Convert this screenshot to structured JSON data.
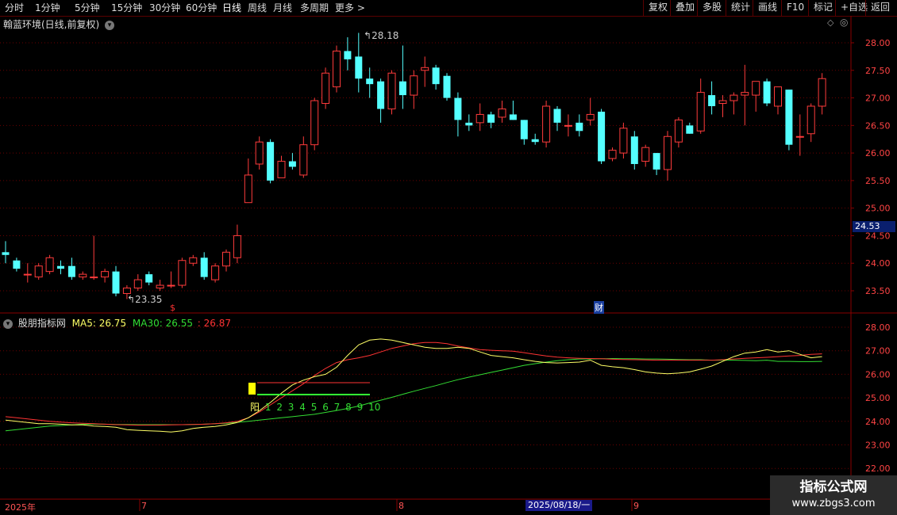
{
  "toolbar": {
    "periods": [
      "分时",
      "1分钟",
      "5分钟",
      "15分钟",
      "30分钟",
      "60分钟",
      "日线",
      "周线",
      "月线",
      "多周期",
      "更多 >"
    ],
    "active_period": "日线",
    "right_buttons": [
      "复权",
      "叠加",
      "多股",
      "统计",
      "画线",
      "F10",
      "标记",
      "+自选",
      "返回"
    ]
  },
  "main_chart": {
    "title": "翰蓝环境(日线,前复权)",
    "price_axis": [
      "28.00",
      "27.50",
      "27.00",
      "26.50",
      "26.00",
      "25.50",
      "25.00",
      "24.50",
      "24.00",
      "23.50"
    ],
    "high_label": "28.18",
    "low_label": "23.35",
    "current_price": "24.53",
    "event_marker_1": "$",
    "event_marker_2": "财"
  },
  "indicator": {
    "name": "股朋指标网",
    "ma5_label": "MA5: 26.75",
    "ma30_label": "MA30: 26.55",
    "extra_value": ": 26.87",
    "count_labels": [
      "阳",
      "1",
      "2",
      "3",
      "4",
      "5",
      "6",
      "7",
      "8",
      "9",
      "10"
    ],
    "axis": [
      "28.00",
      "27.00",
      "26.00",
      "25.00",
      "24.00",
      "23.00",
      "22.00"
    ]
  },
  "time_axis": {
    "labels": [
      "2025年",
      "7",
      "8",
      "9"
    ],
    "cursor_date": "2025/08/18/一"
  },
  "watermark": {
    "line1": "指标公式网",
    "line2": "www.zbgs3.com"
  },
  "colors": {
    "up": "#ff3b3b",
    "down": "#54ffff",
    "ma5": "#ffff66",
    "ma30": "#33dd33",
    "ma_red": "#ff3333",
    "grid": "#6a0000"
  },
  "chart_data": {
    "type": "candlestick",
    "ylim": [
      23.2,
      28.3
    ],
    "candles": [
      {
        "o": 24.2,
        "h": 24.4,
        "l": 24.0,
        "c": 24.15
      },
      {
        "o": 24.05,
        "h": 24.1,
        "l": 23.85,
        "c": 23.9
      },
      {
        "o": 23.8,
        "h": 24.0,
        "l": 23.65,
        "c": 23.8
      },
      {
        "o": 23.75,
        "h": 24.0,
        "l": 23.7,
        "c": 23.95
      },
      {
        "o": 23.85,
        "h": 24.15,
        "l": 23.8,
        "c": 24.1
      },
      {
        "o": 23.95,
        "h": 24.05,
        "l": 23.8,
        "c": 23.9
      },
      {
        "o": 23.95,
        "h": 24.1,
        "l": 23.7,
        "c": 23.75
      },
      {
        "o": 23.75,
        "h": 23.85,
        "l": 23.7,
        "c": 23.8
      },
      {
        "o": 23.75,
        "h": 24.5,
        "l": 23.7,
        "c": 23.75
      },
      {
        "o": 23.75,
        "h": 23.9,
        "l": 23.65,
        "c": 23.85
      },
      {
        "o": 23.85,
        "h": 23.95,
        "l": 23.4,
        "c": 23.45
      },
      {
        "o": 23.45,
        "h": 23.6,
        "l": 23.35,
        "c": 23.55
      },
      {
        "o": 23.55,
        "h": 23.8,
        "l": 23.5,
        "c": 23.7
      },
      {
        "o": 23.8,
        "h": 23.85,
        "l": 23.6,
        "c": 23.65
      },
      {
        "o": 23.55,
        "h": 23.7,
        "l": 23.5,
        "c": 23.6
      },
      {
        "o": 23.6,
        "h": 23.85,
        "l": 23.55,
        "c": 23.6
      },
      {
        "o": 23.6,
        "h": 24.1,
        "l": 23.55,
        "c": 24.05
      },
      {
        "o": 24.0,
        "h": 24.15,
        "l": 23.95,
        "c": 24.1
      },
      {
        "o": 24.1,
        "h": 24.2,
        "l": 23.7,
        "c": 23.75
      },
      {
        "o": 23.7,
        "h": 24.0,
        "l": 23.65,
        "c": 23.95
      },
      {
        "o": 23.95,
        "h": 24.25,
        "l": 23.85,
        "c": 24.2
      },
      {
        "o": 24.1,
        "h": 24.7,
        "l": 24.0,
        "c": 24.5
      },
      {
        "o": 25.1,
        "h": 25.9,
        "l": 25.1,
        "c": 25.6
      },
      {
        "o": 25.8,
        "h": 26.3,
        "l": 25.7,
        "c": 26.2
      },
      {
        "o": 26.2,
        "h": 26.25,
        "l": 25.45,
        "c": 25.5
      },
      {
        "o": 25.55,
        "h": 25.95,
        "l": 25.55,
        "c": 25.85
      },
      {
        "o": 25.85,
        "h": 26.0,
        "l": 25.7,
        "c": 25.75
      },
      {
        "o": 25.6,
        "h": 26.3,
        "l": 25.55,
        "c": 26.15
      },
      {
        "o": 26.15,
        "h": 27.0,
        "l": 26.05,
        "c": 26.95
      },
      {
        "o": 26.9,
        "h": 27.55,
        "l": 26.8,
        "c": 27.45
      },
      {
        "o": 27.2,
        "h": 27.95,
        "l": 27.1,
        "c": 27.85
      },
      {
        "o": 27.85,
        "h": 28.1,
        "l": 27.5,
        "c": 27.7
      },
      {
        "o": 27.75,
        "h": 28.18,
        "l": 27.1,
        "c": 27.35
      },
      {
        "o": 27.35,
        "h": 27.55,
        "l": 27.0,
        "c": 27.25
      },
      {
        "o": 27.3,
        "h": 27.35,
        "l": 26.55,
        "c": 26.8
      },
      {
        "o": 26.8,
        "h": 27.5,
        "l": 26.7,
        "c": 27.45
      },
      {
        "o": 27.3,
        "h": 27.95,
        "l": 26.8,
        "c": 27.05
      },
      {
        "o": 27.05,
        "h": 27.5,
        "l": 26.8,
        "c": 27.4
      },
      {
        "o": 27.5,
        "h": 27.75,
        "l": 27.2,
        "c": 27.55
      },
      {
        "o": 27.55,
        "h": 27.6,
        "l": 27.15,
        "c": 27.25
      },
      {
        "o": 27.4,
        "h": 27.45,
        "l": 26.95,
        "c": 27.0
      },
      {
        "o": 27.0,
        "h": 27.1,
        "l": 26.3,
        "c": 26.6
      },
      {
        "o": 26.55,
        "h": 26.7,
        "l": 26.4,
        "c": 26.5
      },
      {
        "o": 26.55,
        "h": 26.9,
        "l": 26.4,
        "c": 26.7
      },
      {
        "o": 26.7,
        "h": 26.75,
        "l": 26.45,
        "c": 26.55
      },
      {
        "o": 26.65,
        "h": 26.95,
        "l": 26.55,
        "c": 26.8
      },
      {
        "o": 26.7,
        "h": 26.95,
        "l": 26.6,
        "c": 26.6
      },
      {
        "o": 26.6,
        "h": 26.6,
        "l": 26.15,
        "c": 26.25
      },
      {
        "o": 26.25,
        "h": 26.35,
        "l": 26.15,
        "c": 26.2
      },
      {
        "o": 26.2,
        "h": 26.95,
        "l": 26.1,
        "c": 26.85
      },
      {
        "o": 26.8,
        "h": 26.85,
        "l": 26.4,
        "c": 26.55
      },
      {
        "o": 26.5,
        "h": 26.7,
        "l": 26.3,
        "c": 26.5
      },
      {
        "o": 26.55,
        "h": 26.7,
        "l": 26.3,
        "c": 26.4
      },
      {
        "o": 26.6,
        "h": 27.0,
        "l": 26.5,
        "c": 26.7
      },
      {
        "o": 26.75,
        "h": 26.8,
        "l": 25.8,
        "c": 25.85
      },
      {
        "o": 25.9,
        "h": 26.1,
        "l": 25.85,
        "c": 26.05
      },
      {
        "o": 26.0,
        "h": 26.55,
        "l": 25.9,
        "c": 26.45
      },
      {
        "o": 26.3,
        "h": 26.4,
        "l": 25.7,
        "c": 25.8
      },
      {
        "o": 25.85,
        "h": 26.15,
        "l": 25.75,
        "c": 26.1
      },
      {
        "o": 26.0,
        "h": 26.0,
        "l": 25.6,
        "c": 25.7
      },
      {
        "o": 25.7,
        "h": 26.4,
        "l": 25.5,
        "c": 26.3
      },
      {
        "o": 26.2,
        "h": 26.65,
        "l": 26.1,
        "c": 26.6
      },
      {
        "o": 26.5,
        "h": 26.55,
        "l": 26.35,
        "c": 26.35
      },
      {
        "o": 26.4,
        "h": 27.35,
        "l": 26.35,
        "c": 27.1
      },
      {
        "o": 27.05,
        "h": 27.3,
        "l": 26.7,
        "c": 26.85
      },
      {
        "o": 26.9,
        "h": 27.05,
        "l": 26.65,
        "c": 26.95
      },
      {
        "o": 26.95,
        "h": 27.1,
        "l": 26.7,
        "c": 27.05
      },
      {
        "o": 27.05,
        "h": 27.6,
        "l": 26.5,
        "c": 27.1
      },
      {
        "o": 27.05,
        "h": 27.3,
        "l": 26.75,
        "c": 27.3
      },
      {
        "o": 27.3,
        "h": 27.35,
        "l": 26.85,
        "c": 26.9
      },
      {
        "o": 26.85,
        "h": 27.2,
        "l": 26.7,
        "c": 27.2
      },
      {
        "o": 27.15,
        "h": 27.15,
        "l": 26.05,
        "c": 26.15
      },
      {
        "o": 26.3,
        "h": 26.7,
        "l": 25.95,
        "c": 26.3
      },
      {
        "o": 26.35,
        "h": 26.9,
        "l": 26.2,
        "c": 26.85
      },
      {
        "o": 26.85,
        "h": 27.45,
        "l": 26.7,
        "c": 27.35
      }
    ],
    "indicator_ylim": [
      21.8,
      28.3
    ],
    "ma5": [
      24.05,
      24.0,
      23.95,
      23.9,
      23.9,
      23.88,
      23.85,
      23.85,
      23.8,
      23.78,
      23.75,
      23.65,
      23.62,
      23.6,
      23.58,
      23.55,
      23.6,
      23.7,
      23.75,
      23.78,
      23.85,
      23.95,
      24.15,
      24.45,
      24.8,
      25.2,
      25.55,
      25.75,
      25.9,
      26.0,
      26.3,
      26.8,
      27.25,
      27.45,
      27.5,
      27.45,
      27.35,
      27.25,
      27.15,
      27.1,
      27.1,
      27.15,
      27.1,
      26.95,
      26.8,
      26.75,
      26.7,
      26.62,
      26.55,
      26.5,
      26.48,
      26.5,
      26.52,
      26.6,
      26.38,
      26.32,
      26.28,
      26.2,
      26.1,
      26.05,
      26.02,
      26.05,
      26.1,
      26.22,
      26.35,
      26.55,
      26.75,
      26.9,
      26.95,
      27.05,
      26.95,
      27.0,
      26.85,
      26.7,
      26.75
    ],
    "ma30": [
      23.6,
      23.65,
      23.7,
      23.75,
      23.8,
      23.82,
      23.85,
      23.88,
      23.88,
      23.88,
      23.87,
      23.87,
      23.86,
      23.86,
      23.86,
      23.86,
      23.86,
      23.87,
      23.88,
      23.9,
      23.92,
      23.96,
      24.0,
      24.05,
      24.1,
      24.15,
      24.2,
      24.25,
      24.3,
      24.38,
      24.46,
      24.55,
      24.65,
      24.78,
      24.9,
      25.02,
      25.15,
      25.28,
      25.4,
      25.52,
      25.65,
      25.77,
      25.88,
      25.98,
      26.08,
      26.18,
      26.28,
      26.38,
      26.45,
      26.52,
      26.58,
      26.62,
      26.65,
      26.65,
      26.66,
      26.67,
      26.66,
      26.66,
      26.65,
      26.65,
      26.64,
      26.63,
      26.62,
      26.62,
      26.6,
      26.6,
      26.6,
      26.59,
      26.58,
      26.6,
      26.55,
      26.55,
      26.54,
      26.54,
      26.55
    ],
    "ma_red": [
      24.2,
      24.15,
      24.1,
      24.05,
      24.0,
      23.97,
      23.94,
      23.92,
      23.9,
      23.88,
      23.86,
      23.85,
      23.84,
      23.84,
      23.84,
      23.85,
      23.86,
      23.87,
      23.88,
      23.9,
      23.94,
      24.0,
      24.15,
      24.4,
      24.7,
      25.0,
      25.3,
      25.6,
      25.95,
      26.25,
      26.5,
      26.62,
      26.7,
      26.8,
      26.95,
      27.1,
      27.2,
      27.3,
      27.35,
      27.35,
      27.3,
      27.2,
      27.12,
      27.05,
      27.02,
      27.0,
      26.98,
      26.92,
      26.85,
      26.78,
      26.73,
      26.7,
      26.68,
      26.67,
      26.66,
      26.64,
      26.63,
      26.62,
      26.61,
      26.6,
      26.6,
      26.6,
      26.6,
      26.6,
      26.6,
      26.62,
      26.65,
      26.68,
      26.7,
      26.72,
      26.75,
      26.78,
      26.8,
      26.85,
      26.87
    ],
    "ylabel": "",
    "xlabel": ""
  }
}
